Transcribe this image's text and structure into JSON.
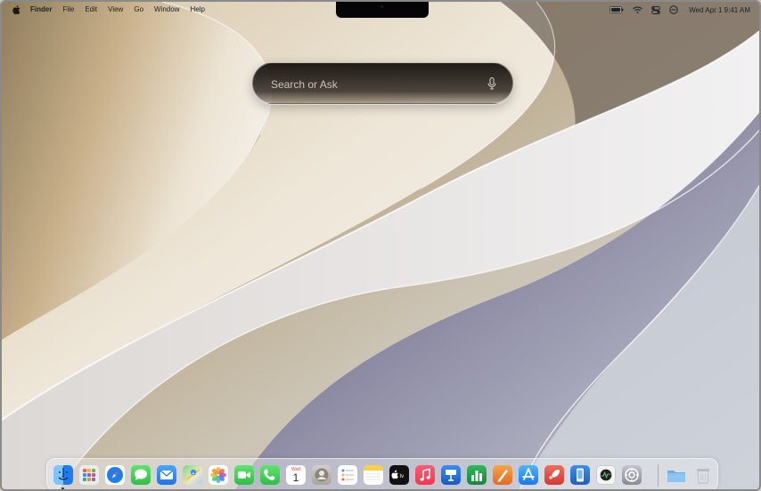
{
  "menubar": {
    "app_name": "Finder",
    "menus": [
      "File",
      "Edit",
      "View",
      "Go",
      "Window",
      "Help"
    ],
    "clock": "Wed Apr 1  9:41 AM",
    "status_icons": [
      "battery-icon",
      "wifi-icon",
      "control-center-icon",
      "siri-icon"
    ]
  },
  "spotlight": {
    "placeholder": "Search or Ask",
    "icon": "microphone-icon"
  },
  "dock": {
    "calendar_month": "Wed",
    "calendar_day": "1",
    "apps": [
      {
        "name": "Finder",
        "icon": "finder-icon",
        "color": "#2f8ef5"
      },
      {
        "name": "Launchpad",
        "icon": "launchpad-icon",
        "color": "#e8e8ee"
      },
      {
        "name": "Safari",
        "icon": "safari-icon",
        "color": "#1e7ef0"
      },
      {
        "name": "Messages",
        "icon": "messages-icon",
        "color": "#3fcf55"
      },
      {
        "name": "Mail",
        "icon": "mail-icon",
        "color": "#2d8cf0"
      },
      {
        "name": "Maps",
        "icon": "maps-icon",
        "color": "#5fbf5a"
      },
      {
        "name": "Photos",
        "icon": "photos-icon",
        "color": "#ffffff"
      },
      {
        "name": "FaceTime",
        "icon": "facetime-icon",
        "color": "#38c04e"
      },
      {
        "name": "Phone",
        "icon": "phone-icon",
        "color": "#39c24f"
      },
      {
        "name": "Calendar",
        "icon": "calendar-icon",
        "color": "#ffffff"
      },
      {
        "name": "Contacts",
        "icon": "contacts-icon",
        "color": "#b8b2ab"
      },
      {
        "name": "Reminders",
        "icon": "reminders-icon",
        "color": "#ffffff"
      },
      {
        "name": "Notes",
        "icon": "notes-icon",
        "color": "#ffffff"
      },
      {
        "name": "TV",
        "icon": "tv-icon",
        "color": "#111111"
      },
      {
        "name": "Music",
        "icon": "music-icon",
        "color": "#f5364f"
      },
      {
        "name": "Keynote",
        "icon": "keynote-icon",
        "color": "#1c6fe0"
      },
      {
        "name": "Numbers",
        "icon": "numbers-icon",
        "color": "#1f9e43"
      },
      {
        "name": "Pages",
        "icon": "pages-icon",
        "color": "#f0802c"
      },
      {
        "name": "App Store",
        "icon": "app-store-icon",
        "color": "#1e8ef5"
      },
      {
        "name": "Rocket",
        "icon": "rocket-icon",
        "color": "#e8453c"
      },
      {
        "name": "Simulator",
        "icon": "simulator-icon",
        "color": "#2c7fdc"
      },
      {
        "name": "Activity Monitor",
        "icon": "activity-monitor-icon",
        "color": "#f4f4f4"
      },
      {
        "name": "System Settings",
        "icon": "system-settings-icon",
        "color": "#9a9aa2"
      },
      {
        "name": "Downloads",
        "icon": "downloads-folder-icon",
        "color": "#7fb6ea"
      },
      {
        "name": "Trash",
        "icon": "trash-icon",
        "color": "#d9dde3"
      }
    ]
  },
  "colors": {
    "accent": "#2f8ef5",
    "dock_background": "#ebebf0",
    "spotlight_background": "#1a1410"
  }
}
